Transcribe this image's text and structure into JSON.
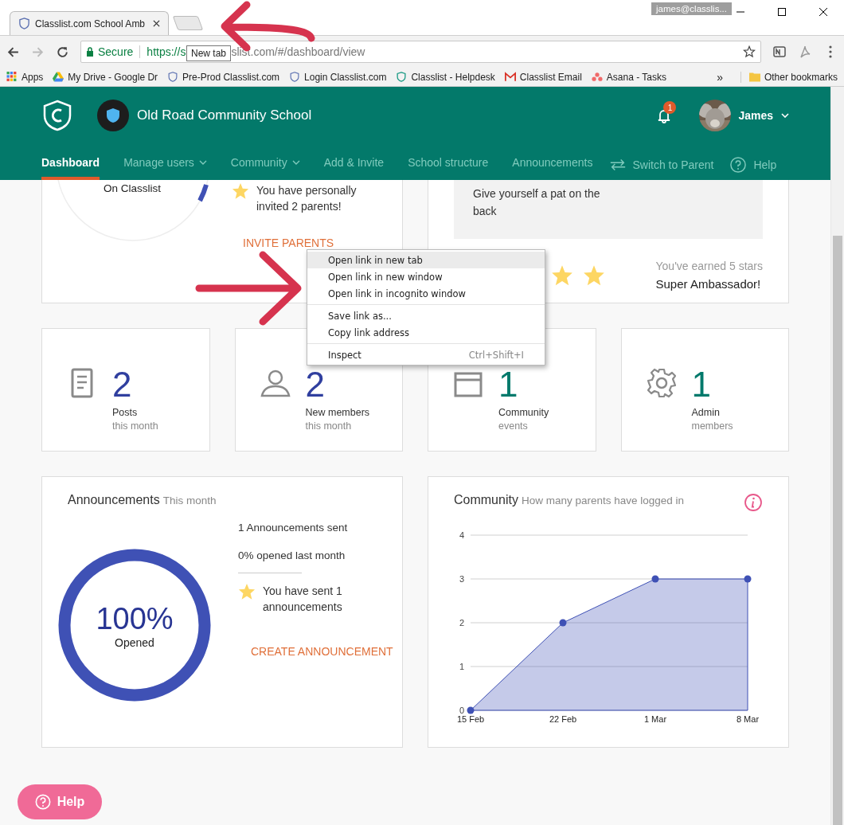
{
  "browser": {
    "tab_title": "Classlist.com School Amb",
    "tooltip": "New tab",
    "user_badge": "james@classlis...",
    "secure_label": "Secure",
    "url_start": "https://s",
    "url_end": "slist.com/#/dashboard/view"
  },
  "bookmarks": [
    {
      "label": "Apps",
      "kind": "apps"
    },
    {
      "label": "My Drive - Google Dr",
      "kind": "drive"
    },
    {
      "label": "Pre-Prod Classlist.com",
      "kind": "shield"
    },
    {
      "label": "Login Classlist.com",
      "kind": "shield"
    },
    {
      "label": "Classlist - Helpdesk",
      "kind": "helpdesk"
    },
    {
      "label": "Classlist Email",
      "kind": "mail"
    },
    {
      "label": "Asana - Tasks",
      "kind": "asana"
    }
  ],
  "bookmarks_more": "»",
  "other_bookmarks": "Other bookmarks",
  "header": {
    "school": "Old Road Community School",
    "notifications": "1",
    "user": "James"
  },
  "nav": [
    {
      "label": "Dashboard",
      "selected": true,
      "dropdown": false
    },
    {
      "label": "Manage users",
      "selected": false,
      "dropdown": true
    },
    {
      "label": "Community",
      "selected": false,
      "dropdown": true
    },
    {
      "label": "Add & Invite",
      "selected": false,
      "dropdown": false
    },
    {
      "label": "School structure",
      "selected": false,
      "dropdown": false
    },
    {
      "label": "Announcements",
      "selected": false,
      "dropdown": false
    }
  ],
  "nav_right": [
    {
      "label": "Switch to Parent",
      "kind": "switch"
    },
    {
      "label": "Help",
      "kind": "help"
    }
  ],
  "invite_card": {
    "donut_label": "On Classlist",
    "message": "You have personally invited 2 parents!",
    "link": "INVITE PARENTS"
  },
  "ambassador_card": {
    "tip": "Give yourself a pat on the back",
    "stars_text": "You've earned 5 stars",
    "title": "Super Ambassador!"
  },
  "stats": [
    {
      "kind": "posts",
      "value": "2",
      "label": "Posts",
      "sublabel": "this month",
      "color": "#303f9f"
    },
    {
      "kind": "members",
      "value": "2",
      "label": "New members",
      "sublabel": "this month",
      "color": "#303f9f"
    },
    {
      "kind": "events",
      "value": "1",
      "label": "Community",
      "sublabel": "events",
      "color": "#00796b"
    },
    {
      "kind": "admins",
      "value": "1",
      "label": "Admin",
      "sublabel": "members",
      "color": "#00796b"
    }
  ],
  "context_menu": {
    "groups": [
      [
        {
          "label": "Open link in new tab",
          "selected": true
        },
        {
          "label": "Open link in new window",
          "selected": false
        },
        {
          "label": "Open link in incognito window",
          "selected": false
        }
      ],
      [
        {
          "label": "Save link as...",
          "selected": false
        },
        {
          "label": "Copy link address",
          "selected": false
        }
      ],
      [
        {
          "label": "Inspect",
          "selected": false,
          "shortcut": "Ctrl+Shift+I"
        }
      ]
    ]
  },
  "announcements": {
    "title": "Announcements",
    "subtitle": "This month",
    "percent": "100%",
    "percent_label": "Opened",
    "level": 1,
    "sent": "1 Announcements sent",
    "opened_last": "0% opened last month",
    "message": "You have sent 1 announcements",
    "link": "CREATE ANNOUNCEMENT"
  },
  "community": {
    "title": "Community",
    "subtitle": "How many parents have logged in",
    "chart_data": {
      "type": "area",
      "categories": [
        "15 Feb",
        "22 Feb",
        "1 Mar",
        "8 Mar"
      ],
      "series": [
        {
          "color": "#3f51b5",
          "values": [
            0,
            2,
            3,
            3
          ]
        }
      ],
      "grid": true,
      "ylim": [
        0,
        4
      ],
      "yticks": [
        0,
        1,
        2,
        3,
        4
      ]
    }
  },
  "help_button": "Help"
}
